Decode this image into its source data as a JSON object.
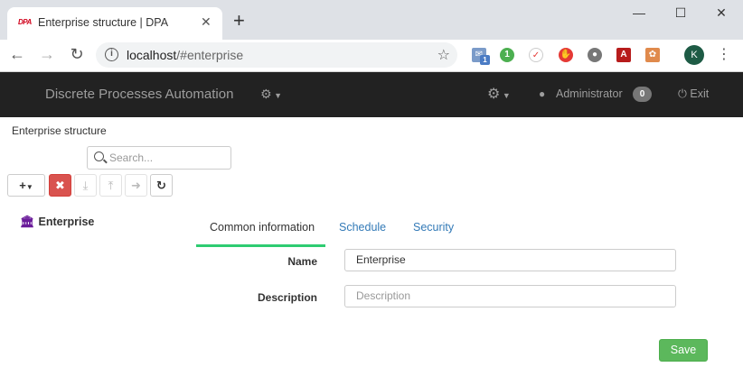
{
  "browser": {
    "tab_favicon_text": "DPA",
    "tab_title": "Enterprise structure | DPA",
    "url_host": "localhost",
    "url_path": "/#enterprise",
    "profile_initial": "K",
    "mail_badge": "1",
    "green_ext_label": "1"
  },
  "navbar": {
    "brand": "Discrete Processes Automation",
    "user": "Administrator",
    "badge": "0",
    "exit_label": "Exit"
  },
  "page": {
    "title": "Enterprise structure",
    "search_placeholder": "Search..."
  },
  "tree": {
    "root": "Enterprise"
  },
  "tabs": [
    "Common information",
    "Schedule",
    "Security"
  ],
  "form": {
    "name_label": "Name",
    "name_value": "Enterprise",
    "description_label": "Description",
    "description_placeholder": "Description",
    "save_label": "Save"
  },
  "colors": {
    "navbar_bg": "#222222",
    "active_tab_underline": "#2ecc71",
    "link": "#337ab7",
    "save_button": "#5cb85c",
    "delete_button": "#d9534f",
    "tree_icon": "#6a1b9a"
  }
}
